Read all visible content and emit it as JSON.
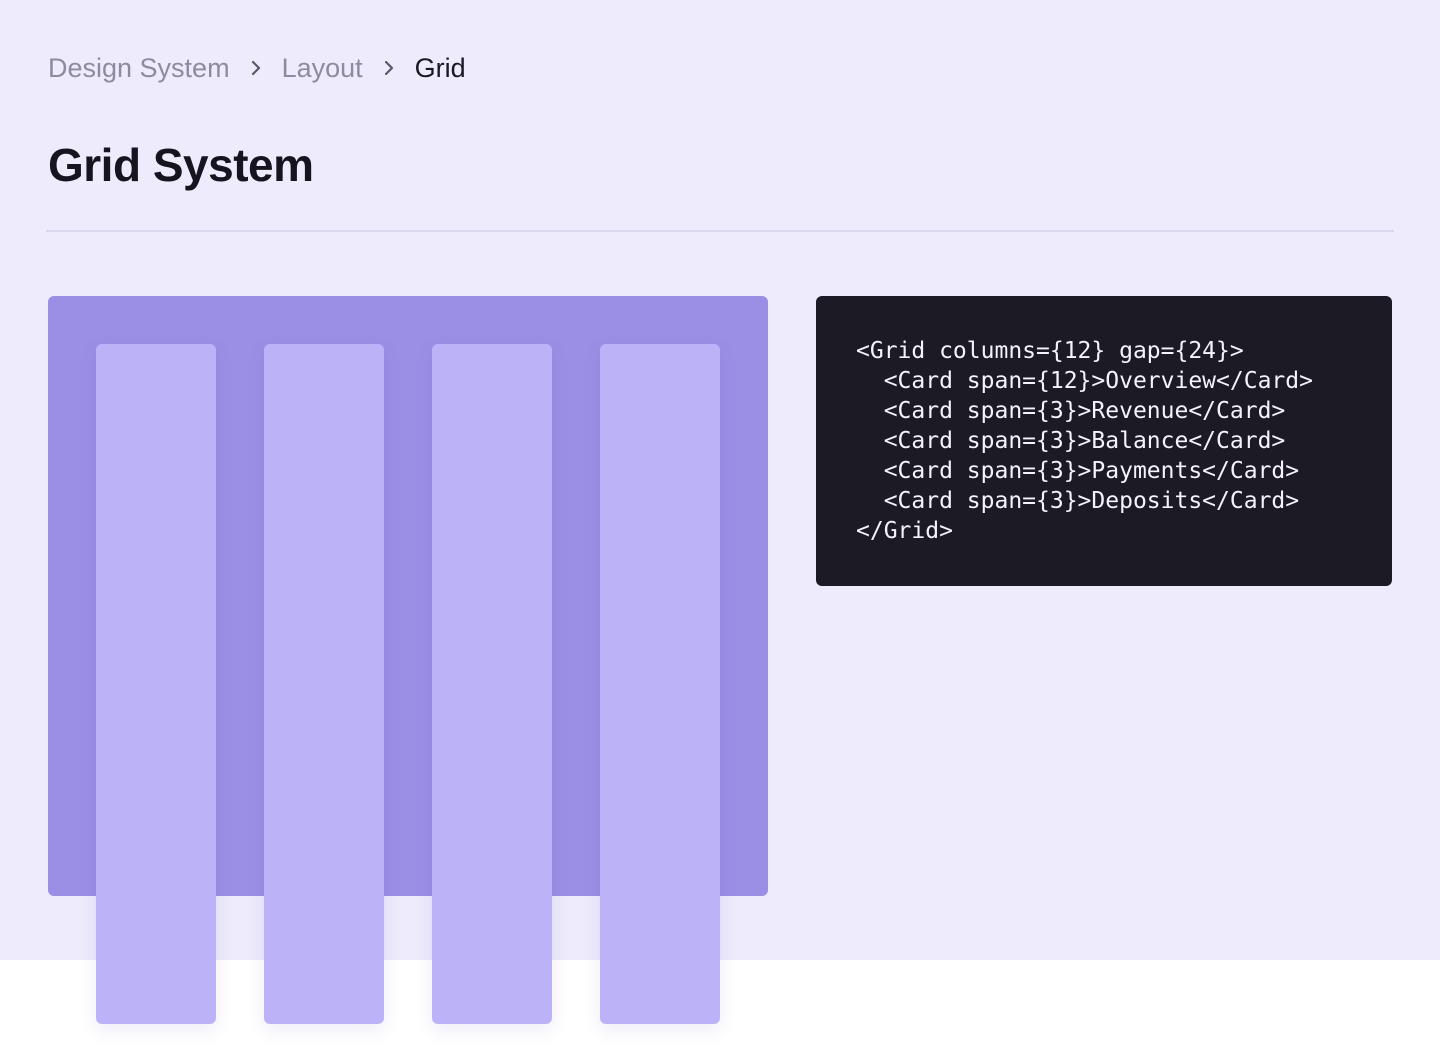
{
  "breadcrumb": {
    "items": [
      "Design System",
      "Layout",
      "Grid"
    ]
  },
  "page": {
    "title": "Grid System"
  },
  "grid_demo": {
    "column_count": 4
  },
  "code": {
    "lines": [
      "<Grid columns={12} gap={24}>",
      "  <Card span={12}>Overview</Card>",
      "  <Card span={3}>Revenue</Card>",
      "  <Card span={3}>Balance</Card>",
      "  <Card span={3}>Payments</Card>",
      "  <Card span={3}>Deposits</Card>",
      "</Grid>"
    ]
  },
  "colors": {
    "page_background": "#eeebfc",
    "grid_container": "#9a8fe4",
    "grid_column": "#bcb2f8",
    "code_background": "#1c1a24",
    "code_text": "#f4f2fb"
  },
  "icons": {
    "breadcrumb_separator": "chevron-right-icon"
  }
}
